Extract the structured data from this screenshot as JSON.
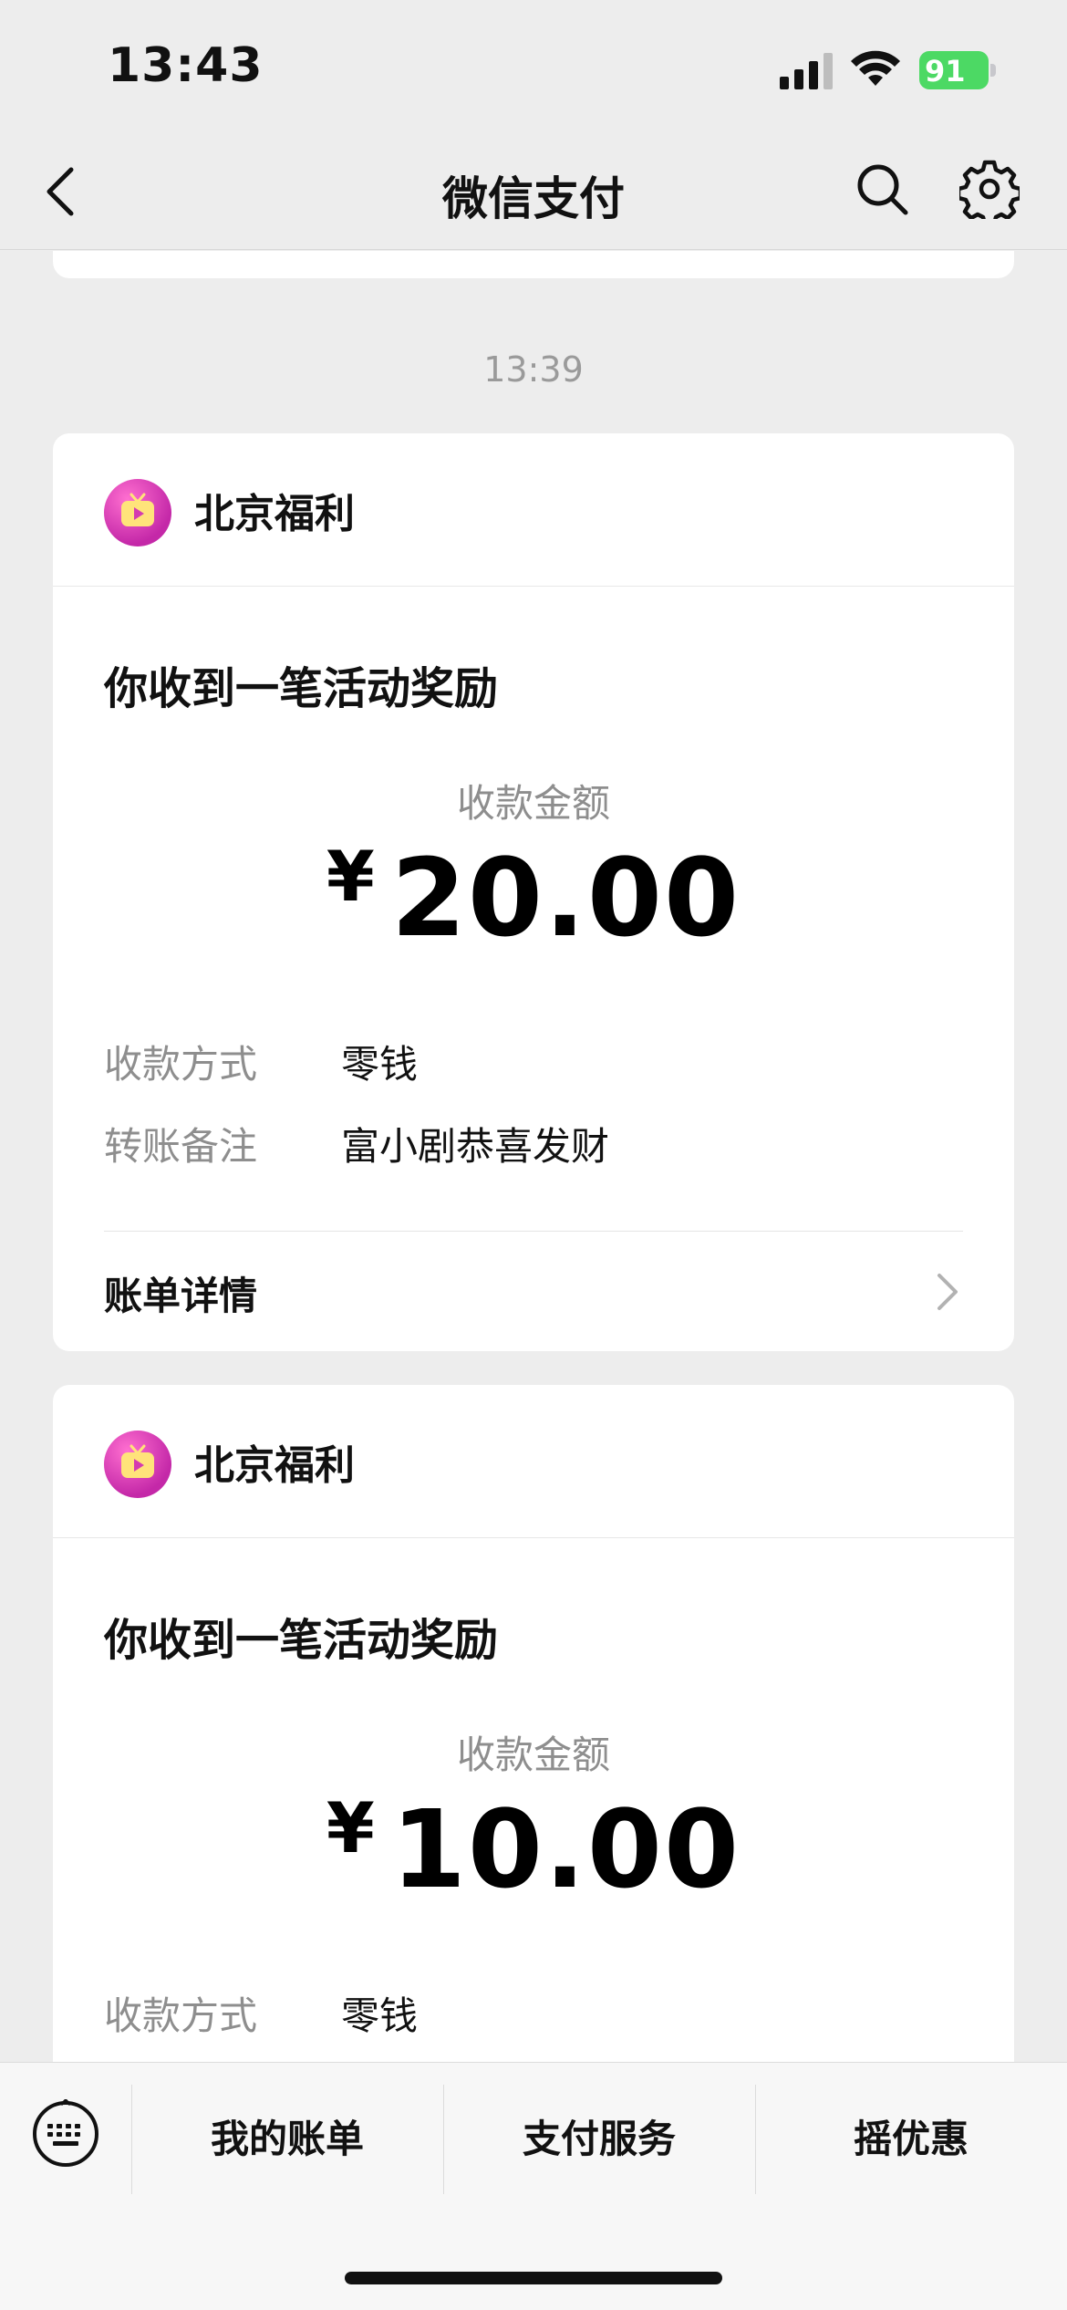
{
  "status_bar": {
    "time": "13:43",
    "battery": "91"
  },
  "nav": {
    "title": "微信支付"
  },
  "timestamp": "13:39",
  "cards": [
    {
      "merchant": "北京福利",
      "title": "你收到一笔活动奖励",
      "amount_label": "收款金额",
      "currency": "¥",
      "amount": "20.00",
      "rows": [
        {
          "label": "收款方式",
          "value": "零钱"
        },
        {
          "label": "转账备注",
          "value": "富小剧恭喜发财"
        }
      ],
      "detail_label": "账单详情"
    },
    {
      "merchant": "北京福利",
      "title": "你收到一笔活动奖励",
      "amount_label": "收款金额",
      "currency": "¥",
      "amount": "10.00",
      "rows": [
        {
          "label": "收款方式",
          "value": "零钱"
        }
      ]
    }
  ],
  "bottom_menu": [
    {
      "label": "我的账单"
    },
    {
      "label": "支付服务"
    },
    {
      "label": "摇优惠"
    }
  ],
  "colors": {
    "background": "#ededed",
    "battery": "#4cd964",
    "merchant_logo": "#c428a8"
  }
}
